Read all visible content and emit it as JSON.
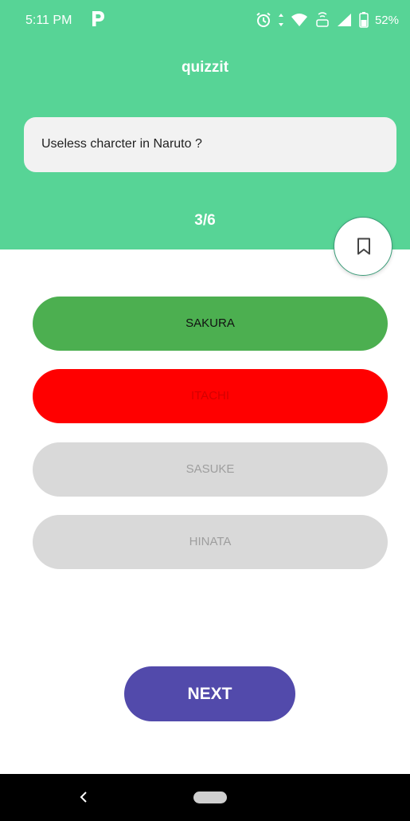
{
  "status_bar": {
    "time": "5:11 PM",
    "battery": "52%",
    "icons": [
      "p-app-icon",
      "alarm-icon",
      "data-arrows-icon",
      "wifi-icon",
      "volte-icon",
      "signal-icon",
      "battery-icon"
    ]
  },
  "header": {
    "title": "quizzit"
  },
  "question": {
    "text": "Useless charcter in Naruto ?"
  },
  "progress": {
    "label": "3/6"
  },
  "bookmark": {
    "icon": "bookmark-icon"
  },
  "options": [
    {
      "label": "SAKURA",
      "state": "correct",
      "color": "#4caf50"
    },
    {
      "label": "ITACHI",
      "state": "wrong",
      "color": "#ff0000"
    },
    {
      "label": "SASUKE",
      "state": "disabled",
      "color": "#d9d9d9"
    },
    {
      "label": "HINATA",
      "state": "disabled",
      "color": "#d9d9d9"
    }
  ],
  "next": {
    "label": "NEXT",
    "color": "#524aab"
  },
  "colors": {
    "header_bg": "#57d496",
    "card_bg": "#f2f2f2"
  },
  "nav_bar": {
    "icons": [
      "back-icon",
      "home-pill-icon"
    ]
  }
}
